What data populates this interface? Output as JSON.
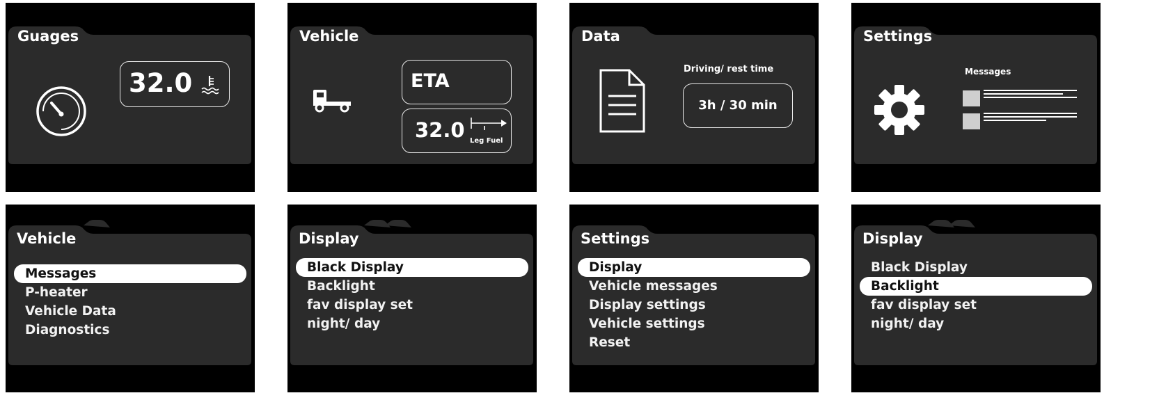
{
  "overview": [
    {
      "title": "Guages",
      "value": "32.0",
      "icons": [
        "speedometer-icon",
        "coolant-temperature-icon"
      ]
    },
    {
      "title": "Vehicle",
      "eta": "ETA",
      "value": "32.0",
      "range_label": "Leg Fuel",
      "icons": [
        "truck-icon",
        "range-arrow-icon"
      ]
    },
    {
      "title": "Data",
      "caption": "Driving/ rest time",
      "value": "3h / 30 min",
      "icons": [
        "document-icon"
      ]
    },
    {
      "title": "Settings",
      "caption": "Messages",
      "icons": [
        "gear-icon",
        "message-list-icon"
      ]
    }
  ],
  "menus": [
    {
      "title": "Vehicle",
      "items": [
        "Messages",
        "P-heater",
        "Vehicle Data",
        "Diagnostics"
      ],
      "selected": 0
    },
    {
      "title": "Display",
      "items": [
        "Black Display",
        "Backlight",
        "fav display set",
        "night/ day"
      ],
      "selected": 0
    },
    {
      "title": "Settings",
      "items": [
        "Display",
        "Vehicle messages",
        "Display settings",
        "Vehicle settings",
        "Reset"
      ],
      "selected": 0
    },
    {
      "title": "Display",
      "items": [
        "Black Display",
        "Backlight",
        "fav display set",
        "night/ day"
      ],
      "selected": 1
    }
  ],
  "colors": {
    "screen": "#000000",
    "panel": "#2b2b2b",
    "text": "#ffffff",
    "highlight": "#ffffff",
    "highlight_text": "#111111"
  }
}
